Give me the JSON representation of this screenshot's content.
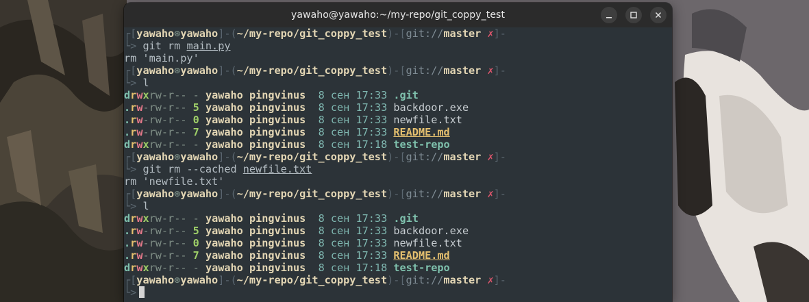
{
  "window": {
    "title": "yawaho@yawaho:~/my-repo/git_coppy_test"
  },
  "prompt": {
    "user": "yawaho",
    "at_symbol": "⊛",
    "host": "yawaho",
    "path": "~/my-repo/git_coppy_test",
    "git_prefix": "git://",
    "branch": "master",
    "dirty_mark": "✗",
    "arrow": "└>"
  },
  "commands": [
    {
      "cmd": "git rm",
      "arg": "main.py",
      "output": "rm 'main.py'"
    },
    {
      "cmd": "l",
      "arg": "",
      "output": ""
    },
    {
      "cmd": "git rm --cached",
      "arg": "newfile.txt",
      "output": "rm 'newfile.txt'"
    },
    {
      "cmd": "l",
      "arg": "",
      "output": ""
    }
  ],
  "listing1": [
    {
      "type": "d",
      "p_r": "r",
      "p_w": "w",
      "p_x": "x",
      "rest": "rw-r--",
      "size": "-",
      "owner": "yawaho",
      "group": "pingvinus",
      "day": "8",
      "month": "сен",
      "time": "17:33",
      "name": ".git",
      "kind": "dir"
    },
    {
      "type": ".",
      "p_r": "r",
      "p_w": "w",
      "p_x": "-",
      "rest": "rw-r--",
      "size": "5",
      "owner": "yawaho",
      "group": "pingvinus",
      "day": "8",
      "month": "сен",
      "time": "17:33",
      "name": "backdoor.exe",
      "kind": "plain"
    },
    {
      "type": ".",
      "p_r": "r",
      "p_w": "w",
      "p_x": "-",
      "rest": "rw-r--",
      "size": "0",
      "owner": "yawaho",
      "group": "pingvinus",
      "day": "8",
      "month": "сен",
      "time": "17:33",
      "name": "newfile.txt",
      "kind": "plain"
    },
    {
      "type": ".",
      "p_r": "r",
      "p_w": "w",
      "p_x": "-",
      "rest": "rw-r--",
      "size": "7",
      "owner": "yawaho",
      "group": "pingvinus",
      "day": "8",
      "month": "сен",
      "time": "17:33",
      "name": "README.md",
      "kind": "md"
    },
    {
      "type": "d",
      "p_r": "r",
      "p_w": "w",
      "p_x": "x",
      "rest": "rw-r--",
      "size": "-",
      "owner": "yawaho",
      "group": "pingvinus",
      "day": "8",
      "month": "сен",
      "time": "17:18",
      "name": "test-repo",
      "kind": "dir"
    }
  ],
  "listing2": [
    {
      "type": "d",
      "p_r": "r",
      "p_w": "w",
      "p_x": "x",
      "rest": "rw-r--",
      "size": "-",
      "owner": "yawaho",
      "group": "pingvinus",
      "day": "8",
      "month": "сен",
      "time": "17:33",
      "name": ".git",
      "kind": "dir"
    },
    {
      "type": ".",
      "p_r": "r",
      "p_w": "w",
      "p_x": "-",
      "rest": "rw-r--",
      "size": "5",
      "owner": "yawaho",
      "group": "pingvinus",
      "day": "8",
      "month": "сен",
      "time": "17:33",
      "name": "backdoor.exe",
      "kind": "plain"
    },
    {
      "type": ".",
      "p_r": "r",
      "p_w": "w",
      "p_x": "-",
      "rest": "rw-r--",
      "size": "0",
      "owner": "yawaho",
      "group": "pingvinus",
      "day": "8",
      "month": "сен",
      "time": "17:33",
      "name": "newfile.txt",
      "kind": "plain"
    },
    {
      "type": ".",
      "p_r": "r",
      "p_w": "w",
      "p_x": "-",
      "rest": "rw-r--",
      "size": "7",
      "owner": "yawaho",
      "group": "pingvinus",
      "day": "8",
      "month": "сен",
      "time": "17:33",
      "name": "README.md",
      "kind": "md"
    },
    {
      "type": "d",
      "p_r": "r",
      "p_w": "w",
      "p_x": "x",
      "rest": "rw-r--",
      "size": "-",
      "owner": "yawaho",
      "group": "pingvinus",
      "day": "8",
      "month": "сен",
      "time": "17:18",
      "name": "test-repo",
      "kind": "dir"
    }
  ],
  "colors": {
    "terminal_bg": "#2c3338",
    "titlebar_bg": "#2b2b2b",
    "accent_yellow": "#e3d6b4",
    "dirty_red": "#d9556b"
  }
}
